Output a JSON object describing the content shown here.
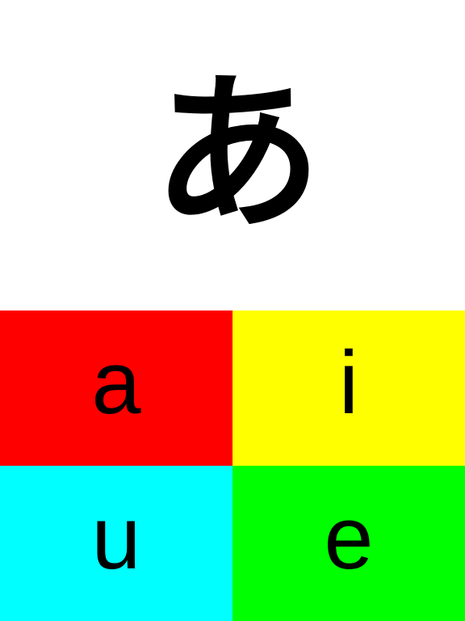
{
  "prompt": {
    "character": "あ"
  },
  "answers": [
    {
      "label": "a",
      "color": "#ff0000"
    },
    {
      "label": "i",
      "color": "#ffff00"
    },
    {
      "label": "u",
      "color": "#00ffff"
    },
    {
      "label": "e",
      "color": "#00ff00"
    }
  ]
}
